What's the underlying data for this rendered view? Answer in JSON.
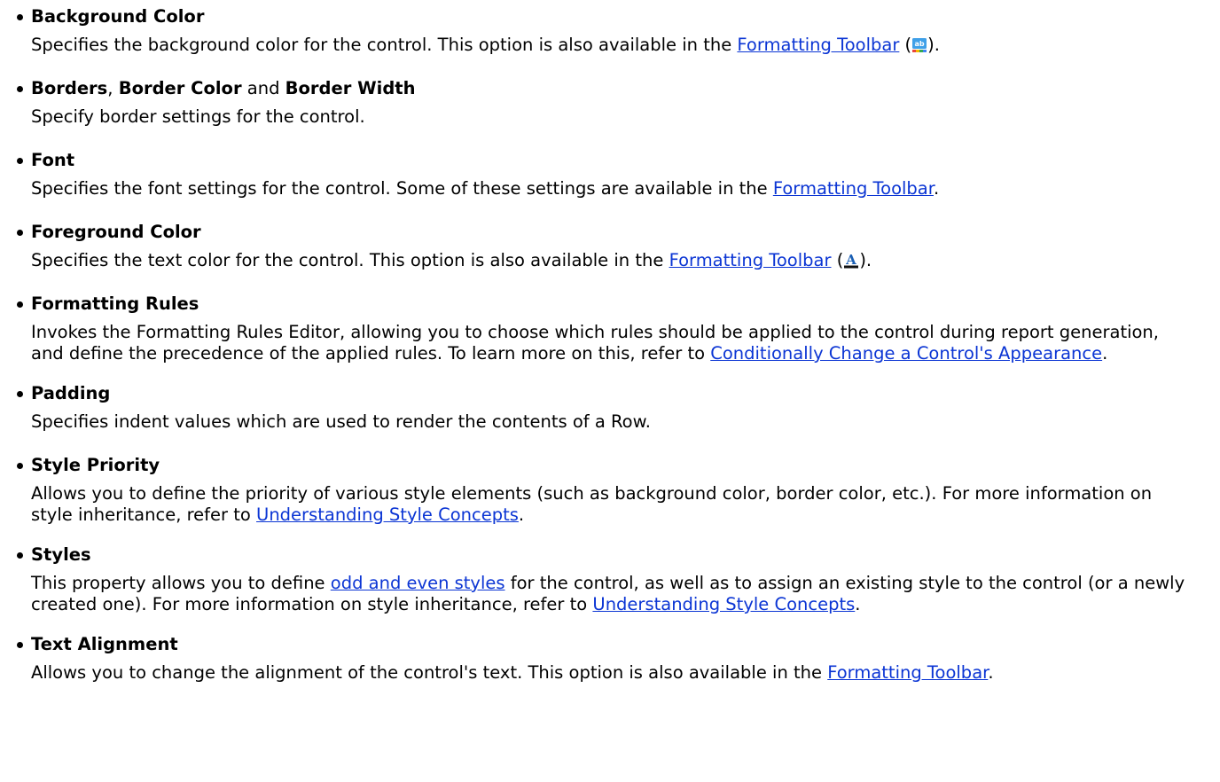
{
  "items": [
    {
      "title": "Background Color",
      "desc_before": "Specifies the background color for the control. This option is also available in the ",
      "link": "Formatting Toolbar",
      "desc_after": " (",
      "icon": "background-color-icon",
      "desc_end": ")."
    },
    {
      "title_a": "Borders",
      "sep1": ", ",
      "title_b": "Border Color",
      "sep2": " and ",
      "title_c": "Border Width",
      "desc": "Specify border settings for the control."
    },
    {
      "title": "Font",
      "desc_before": "Specifies the font settings for the control. Some of these settings are available in the ",
      "link": "Formatting Toolbar",
      "desc_end": "."
    },
    {
      "title": "Foreground Color",
      "desc_before": "Specifies the text color for the control. This option is also available in the ",
      "link": "Formatting Toolbar",
      "desc_after": " (",
      "icon": "foreground-color-icon",
      "desc_end": ")."
    },
    {
      "title": "Formatting Rules",
      "desc_before": "Invokes the Formatting Rules Editor, allowing you to choose which rules should be applied to the control during report generation, and define the precedence of the applied rules. To learn more on this, refer to ",
      "link": "Conditionally Change a Control's Appearance",
      "desc_end": "."
    },
    {
      "title": "Padding",
      "desc": "Specifies indent values which are used to render the contents of a Row."
    },
    {
      "title": "Style Priority",
      "desc_before": "Allows you to define the priority of various style elements (such as background color, border color, etc.). For more information on style inheritance, refer to ",
      "link": "Understanding Style Concepts",
      "desc_end": "."
    },
    {
      "title": "Styles",
      "desc_before": "This property allows you to define ",
      "link1": "odd and even styles",
      "desc_mid": " for the control, as well as to assign an existing style to the control (or a newly created one). For more information on style inheritance, refer to ",
      "link2": "Understanding Style Concepts",
      "desc_end": "."
    },
    {
      "title": "Text Alignment",
      "desc_before": "Allows you to change the alignment of the control's text. This option is also available in the ",
      "link": "Formatting Toolbar",
      "desc_end": "."
    }
  ]
}
